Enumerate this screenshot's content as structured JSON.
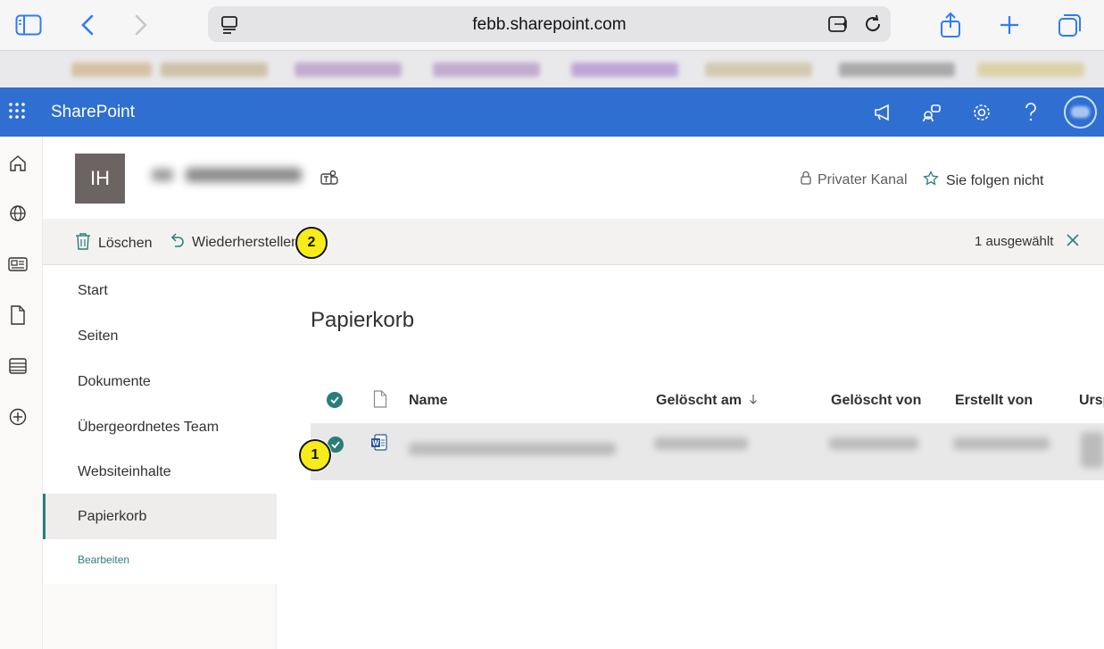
{
  "browser": {
    "url": "febb.sharepoint.com"
  },
  "suite": {
    "brand": "SharePoint"
  },
  "site": {
    "logo_initials": "IH",
    "privacy_label": "Privater Kanal",
    "follow_label": "Sie folgen nicht"
  },
  "commands": {
    "delete_label": "Löschen",
    "restore_label": "Wiederherstellen",
    "selected_count": "1 ausgewählt"
  },
  "nav": {
    "items": [
      {
        "label": "Start"
      },
      {
        "label": "Seiten"
      },
      {
        "label": "Dokumente"
      },
      {
        "label": "Übergeordnetes Team"
      },
      {
        "label": "Websiteinhalte"
      },
      {
        "label": "Papierkorb"
      }
    ],
    "edit_label": "Bearbeiten"
  },
  "main": {
    "title": "Papierkorb",
    "columns": {
      "name": "Name",
      "deleted_on": "Gelöscht am",
      "deleted_by": "Gelöscht von",
      "created_by": "Erstellt von",
      "origin": "Ursp"
    }
  },
  "markers": {
    "one": "1",
    "two": "2"
  },
  "colors": {
    "suite_bar": "#2f6fd1",
    "accent": "#2b7e78",
    "marker": "#f5ec1a"
  }
}
